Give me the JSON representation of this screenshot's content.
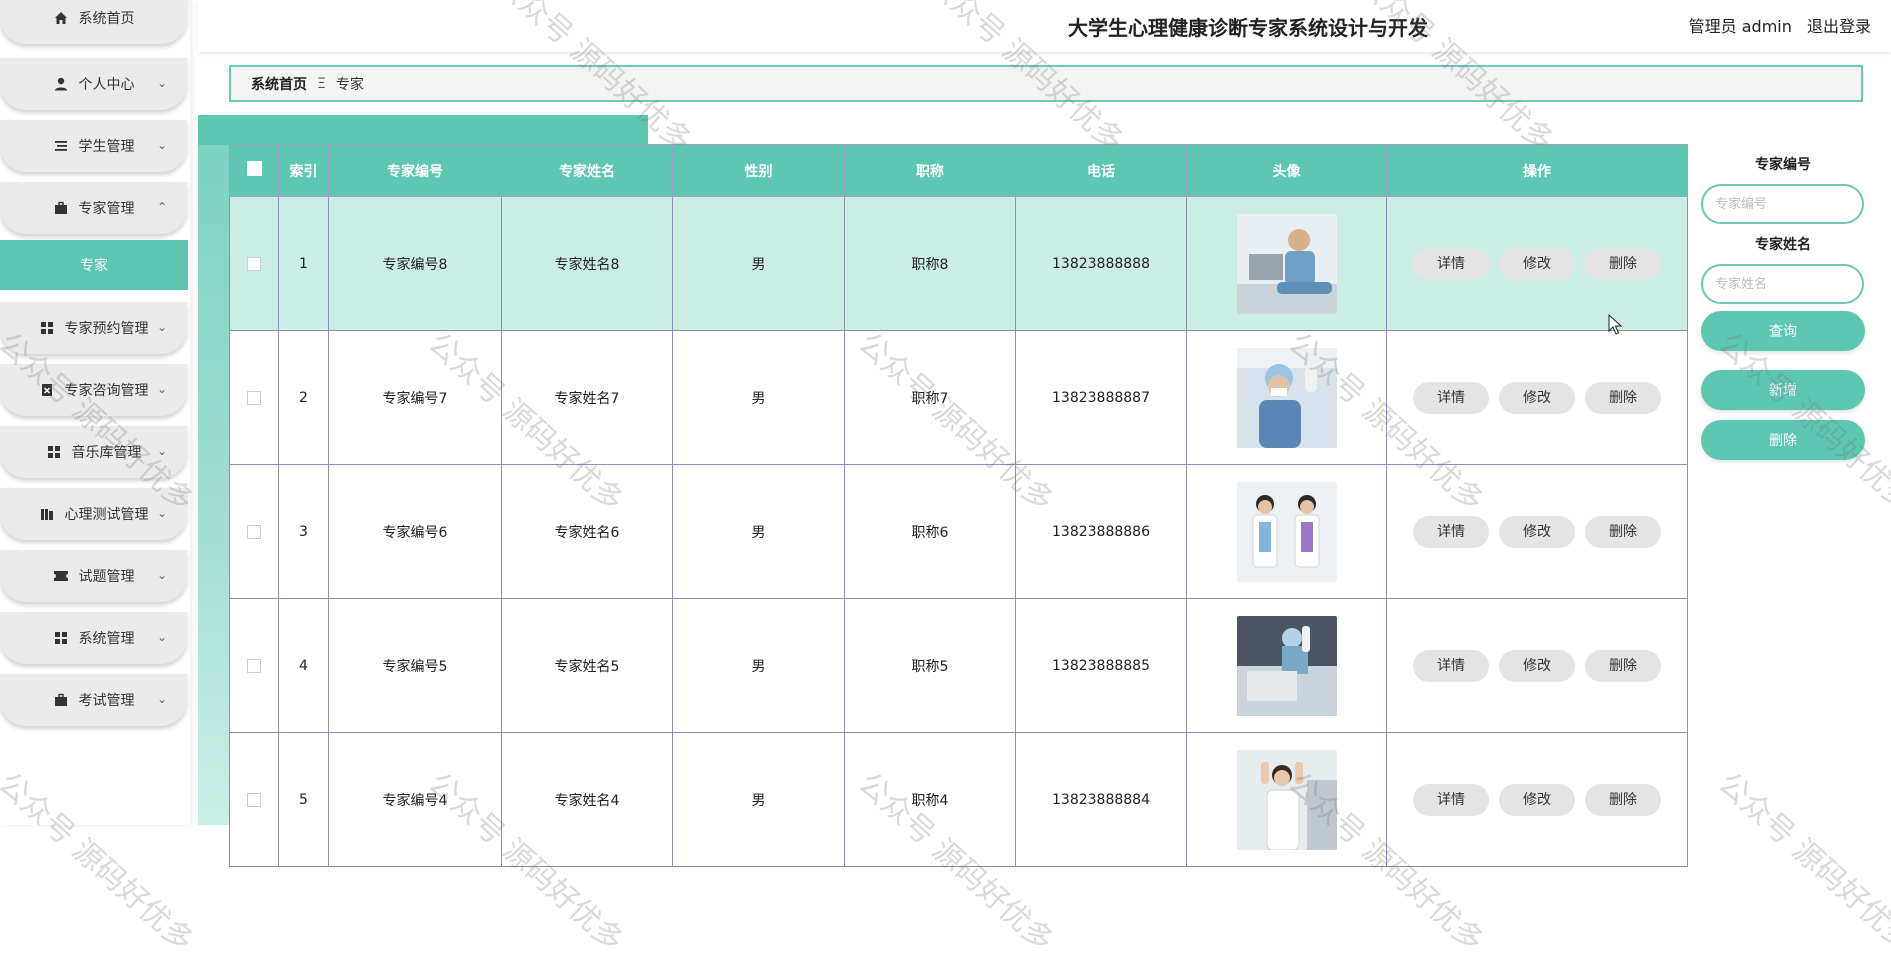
{
  "app": {
    "title": "大学生心理健康诊断专家系统设计与开发",
    "user_role": "管理员 admin",
    "logout": "退出登录"
  },
  "sidebar": {
    "items": [
      {
        "label": "系统首页",
        "icon": "home-icon",
        "chevron": ""
      },
      {
        "label": "个人中心",
        "icon": "user-icon",
        "chevron": "⌄"
      },
      {
        "label": "学生管理",
        "icon": "list-icon",
        "chevron": "⌄"
      },
      {
        "label": "专家管理",
        "icon": "briefcase-icon",
        "chevron": "⌃"
      },
      {
        "label": "专家预约管理",
        "icon": "grid-icon",
        "chevron": "⌄"
      },
      {
        "label": "专家咨询管理",
        "icon": "doc-x-icon",
        "chevron": "⌄"
      },
      {
        "label": "音乐库管理",
        "icon": "grid-icon",
        "chevron": "⌄"
      },
      {
        "label": "心理测试管理",
        "icon": "books-icon",
        "chevron": "⌄"
      },
      {
        "label": "试题管理",
        "icon": "ticket-icon",
        "chevron": "⌄"
      },
      {
        "label": "系统管理",
        "icon": "grid-icon",
        "chevron": "⌄"
      },
      {
        "label": "考试管理",
        "icon": "briefcase-icon",
        "chevron": "⌄"
      }
    ],
    "active_sub": "专家"
  },
  "breadcrumb": {
    "home": "系统首页",
    "sep": "Ξ",
    "current": "专家"
  },
  "table": {
    "headers": [
      "索引",
      "专家编号",
      "专家姓名",
      "性别",
      "职称",
      "电话",
      "头像",
      "操作"
    ],
    "actions": [
      "详情",
      "修改",
      "删除"
    ],
    "rows": [
      {
        "index": "1",
        "no": "专家编号8",
        "name": "专家姓名8",
        "gender": "男",
        "title": "职称8",
        "phone": "13823888888",
        "avatar": "doctor-laptop-photo"
      },
      {
        "index": "2",
        "no": "专家编号7",
        "name": "专家姓名7",
        "gender": "男",
        "title": "职称7",
        "phone": "13823888887",
        "avatar": "surgeon-mask-photo"
      },
      {
        "index": "3",
        "no": "专家编号6",
        "name": "专家姓名6",
        "gender": "男",
        "title": "职称6",
        "phone": "13823888886",
        "avatar": "two-doctors-photo"
      },
      {
        "index": "4",
        "no": "专家编号5",
        "name": "专家姓名5",
        "gender": "男",
        "title": "职称5",
        "phone": "13823888885",
        "avatar": "surgery-photo"
      },
      {
        "index": "5",
        "no": "专家编号4",
        "name": "专家姓名4",
        "gender": "男",
        "title": "职称4",
        "phone": "13823888884",
        "avatar": "nurse-photo"
      }
    ]
  },
  "search": {
    "no_label": "专家编号",
    "no_placeholder": "专家编号",
    "name_label": "专家姓名",
    "name_placeholder": "专家姓名",
    "query": "查询",
    "add": "新增",
    "delete": "删除"
  },
  "watermark": "公众号 源码好优多",
  "colors": {
    "accent": "#5ec7b1",
    "highlight_row": "#cbede6",
    "button_gray": "#e4e4e4"
  }
}
